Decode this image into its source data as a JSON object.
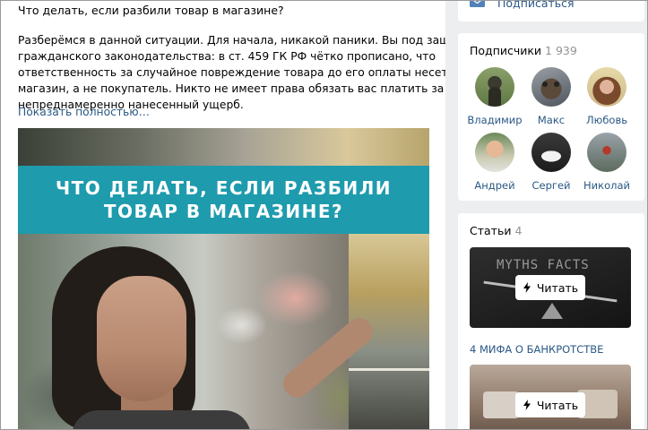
{
  "post": {
    "title": "Что делать, если разбили товар в магазине?",
    "body_lines": [
      "Разберёмся в данной ситуации. Для начала, никакой паники. Вы под защитой",
      "гражданского законодательства: в ст. 459 ГК РФ чётко прописано, что",
      "ответственность за случайное повреждение товара до его оплаты несет именно",
      "магазин, а не покупатель. Никто не имеет права обязать вас платить за",
      "непреднамеренно нанесенный ущерб."
    ],
    "show_more": "Показать полностью…",
    "image": {
      "banner_line1": "ЧТО ДЕЛАТЬ, ЕСЛИ РАЗБИЛИ",
      "banner_line2": "ТОВАР В МАГАЗИНЕ?",
      "banner_color": "#1e9bad"
    }
  },
  "subscribe": {
    "label": "Подписаться",
    "icon": "mail-icon"
  },
  "followers": {
    "title": "Подписчики",
    "count": "1 939",
    "items": [
      {
        "name": "Владимир"
      },
      {
        "name": "Макс"
      },
      {
        "name": "Любовь"
      },
      {
        "name": "Андрей"
      },
      {
        "name": "Сергей"
      },
      {
        "name": "Николай"
      }
    ]
  },
  "articles": {
    "title": "Статьи",
    "count": "4",
    "read_label": "Читать",
    "items": [
      {
        "title": "4 МИФА О БАНКРОТСТВЕ",
        "thumb_text": "MYTHS  FACTS"
      },
      {
        "title": ""
      }
    ]
  },
  "colors": {
    "link": "#2a5885",
    "page_bg": "#edeef0",
    "muted": "#939393"
  }
}
